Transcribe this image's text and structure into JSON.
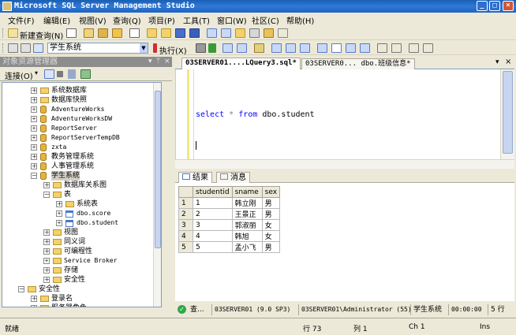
{
  "window": {
    "title": "Microsoft SQL Server Management Studio",
    "controls": [
      "_",
      "□",
      "×"
    ]
  },
  "menu": [
    "文件(F)",
    "编辑(E)",
    "视图(V)",
    "查询(Q)",
    "项目(P)",
    "工具(T)",
    "窗口(W)",
    "社区(C)",
    "帮助(H)"
  ],
  "toolbar1": {
    "new_query": "新建查询(N)"
  },
  "toolbar2": {
    "database": "学生系统",
    "execute": "执行(X)"
  },
  "object_explorer": {
    "title": "对象资源管理器",
    "connect": "连接(O)",
    "nodes": [
      {
        "label": "系统数据库",
        "expander": "+",
        "icon": "folder-icon",
        "font": "sans"
      },
      {
        "label": "数据库快照",
        "expander": "+",
        "icon": "folder-icon",
        "font": "sans"
      },
      {
        "label": "AdventureWorks",
        "expander": "+",
        "icon": "database-icon",
        "font": "mono"
      },
      {
        "label": "AdventureWorksDW",
        "expander": "+",
        "icon": "database-icon",
        "font": "mono"
      },
      {
        "label": "ReportServer",
        "expander": "+",
        "icon": "database-icon",
        "font": "mono"
      },
      {
        "label": "ReportServerTempDB",
        "expander": "+",
        "icon": "database-icon",
        "font": "mono"
      },
      {
        "label": "zxta",
        "expander": "+",
        "icon": "database-icon",
        "font": "mono"
      },
      {
        "label": "教务管理系统",
        "expander": "+",
        "icon": "database-icon",
        "font": "sans"
      },
      {
        "label": "人事管理系统",
        "expander": "+",
        "icon": "database-icon",
        "font": "sans"
      },
      {
        "label": "学生系统",
        "expander": "−",
        "icon": "database-icon",
        "font": "sans",
        "selected": true
      },
      {
        "label": "数据库关系图",
        "expander": "+",
        "icon": "folder-icon",
        "font": "sans"
      },
      {
        "label": "表",
        "expander": "−",
        "icon": "folder-icon",
        "font": "sans"
      },
      {
        "label": "系统表",
        "expander": "+",
        "icon": "folder-icon",
        "font": "sans"
      },
      {
        "label": "dbo.score",
        "expander": "+",
        "icon": "table-icon",
        "font": "mono"
      },
      {
        "label": "dbo.student",
        "expander": "+",
        "icon": "table-icon",
        "font": "mono"
      },
      {
        "label": "视图",
        "expander": "+",
        "icon": "folder-icon",
        "font": "sans"
      },
      {
        "label": "同义词",
        "expander": "+",
        "icon": "folder-icon",
        "font": "sans"
      },
      {
        "label": "可编程性",
        "expander": "+",
        "icon": "folder-icon",
        "font": "sans"
      },
      {
        "label": "Service Broker",
        "expander": "+",
        "icon": "folder-icon",
        "font": "mono"
      },
      {
        "label": "存储",
        "expander": "+",
        "icon": "folder-icon",
        "font": "sans"
      },
      {
        "label": "安全性",
        "expander": "+",
        "icon": "folder-icon",
        "font": "sans"
      },
      {
        "label": "安全性",
        "expander": "−",
        "icon": "folder-icon",
        "font": "sans"
      },
      {
        "label": "登录名",
        "expander": "+",
        "icon": "folder-icon",
        "font": "sans"
      },
      {
        "label": "服务器角色",
        "expander": "+",
        "icon": "folder-icon",
        "font": "sans"
      }
    ]
  },
  "editor_tabs": [
    {
      "label": "03SERVER01....LQuery3.sql*",
      "active": true
    },
    {
      "label": "03SERVER0... dbo.班级信息*",
      "active": false
    }
  ],
  "editor": {
    "kw1": "select",
    "op": "*",
    "kw2": "from",
    "rest": "dbo.student"
  },
  "results": {
    "tabs": [
      {
        "label": "结果",
        "icon": "grid-icon"
      },
      {
        "label": "消息",
        "icon": "message-icon"
      }
    ],
    "columns": [
      "studentid",
      "sname",
      "sex"
    ],
    "rows": [
      {
        "n": "1",
        "id": "1",
        "name": "韩立刚",
        "sex": "男"
      },
      {
        "n": "2",
        "id": "2",
        "name": "王景正",
        "sex": "男"
      },
      {
        "n": "3",
        "id": "3",
        "name": "郭淑丽",
        "sex": "女"
      },
      {
        "n": "4",
        "id": "4",
        "name": "韩旭",
        "sex": "女"
      },
      {
        "n": "5",
        "id": "5",
        "name": "孟小飞",
        "sex": "男"
      }
    ]
  },
  "query_status": {
    "state": "查...",
    "server": "03SERVER01 (9.0 SP3)",
    "user": "03SERVER01\\Administrator (55)",
    "db": "学生系统",
    "time": "00:00:00",
    "rows": "5 行"
  },
  "statusbar": {
    "ready": "就绪",
    "line": "行 73",
    "col": "列 1",
    "ch": "Ch 1",
    "mode": "Ins"
  }
}
